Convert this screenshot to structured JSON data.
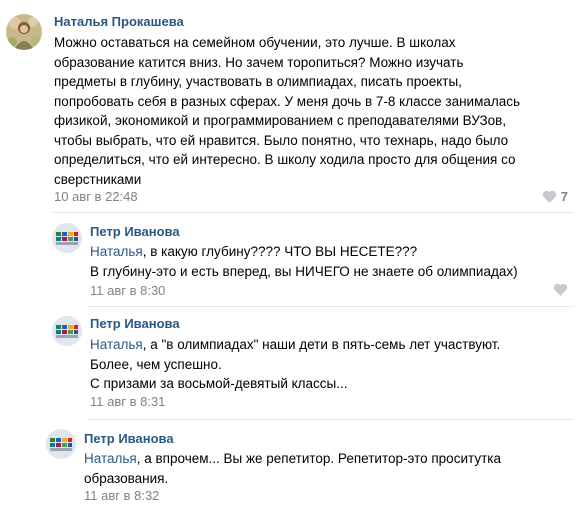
{
  "colors": {
    "link": "#2a5885",
    "meta": "#828282",
    "divider": "#e7e8ec",
    "heart": "#c5c9d0"
  },
  "comments": [
    {
      "author": "Наталья Прокашева",
      "lines": [
        "Можно оставаться на семейном обучении, это лучше. В школах",
        "образование катится вниз. Но зачем торопиться? Можно изучать",
        "предметы в глубину, участвовать в олимпиадах, писать проекты,",
        "попробовать себя в разных сферах. У меня дочь в 7-8 классе занималась",
        "физикой, экономикой и программированием с преподавателями ВУЗов,",
        "чтобы выбрать, что ей нравится. Было понятно, что технарь, надо было",
        "определиться, что ей интересно. В школу ходила просто для общения со",
        "сверстниками"
      ],
      "date": "10 авг в 22:48",
      "likes": "7",
      "like_icon": "heart-icon"
    }
  ],
  "replies": [
    {
      "author": "Петр Иванова",
      "mention": "Наталья",
      "first_line_rest": ", в какую глубину???? ЧТО ВЫ НЕСЕТЕ???",
      "lines": [
        "В глубину-это и есть вперед, вы НИЧЕГО не знаете об олимпиадах)"
      ],
      "date": "11 авг в 8:30",
      "like_icon": "heart-icon"
    },
    {
      "author": "Петр Иванова",
      "mention": "Наталья",
      "first_line_rest": ", а \"в олимпиадах\" наши дети в пять-семь лет участвуют.",
      "lines": [
        "Более, чем успешно.",
        "С призами за восьмой-девятый классы..."
      ],
      "date": "11 авг в 8:31"
    },
    {
      "author": "Петр Иванова",
      "mention": "Наталья",
      "first_line_rest": ", а впрочем... Вы же репетитор. Репетитор-это проситутка",
      "lines": [
        "образования."
      ],
      "date": "11 авг в 8:32"
    }
  ]
}
